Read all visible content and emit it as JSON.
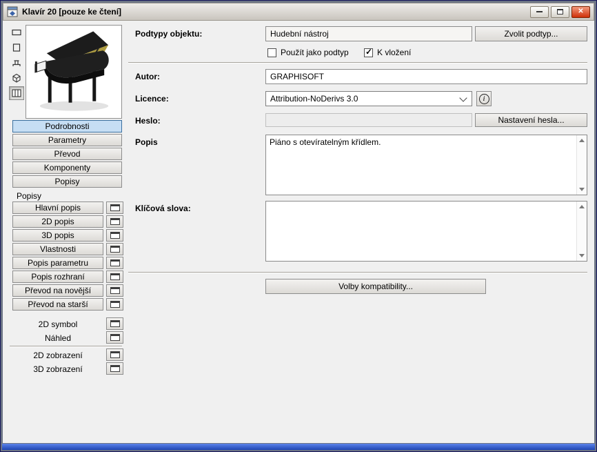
{
  "window": {
    "title": "Klavír 20 [pouze ke čtení]"
  },
  "sidebar": {
    "tools": [
      {
        "icon": "rect-icon",
        "selected": false
      },
      {
        "icon": "square-icon",
        "selected": false
      },
      {
        "icon": "stamp-icon",
        "selected": false
      },
      {
        "icon": "cube-icon",
        "selected": false
      },
      {
        "icon": "film-icon",
        "selected": true
      }
    ],
    "nav": [
      {
        "label": "Podrobnosti",
        "selected": true
      },
      {
        "label": "Parametry",
        "selected": false
      },
      {
        "label": "Převod",
        "selected": false
      },
      {
        "label": "Komponenty",
        "selected": false
      },
      {
        "label": "Popisy",
        "selected": false
      }
    ],
    "scripts_heading": "Popisy",
    "scripts": [
      {
        "label": "Hlavní popis"
      },
      {
        "label": "2D popis"
      },
      {
        "label": "3D popis"
      },
      {
        "label": "Vlastnosti"
      },
      {
        "label": "Popis parametru"
      },
      {
        "label": "Popis rozhraní"
      },
      {
        "label": "Převod na novější"
      },
      {
        "label": "Převod na starší"
      }
    ],
    "previews": [
      {
        "label": "2D symbol"
      },
      {
        "label": "Náhled"
      }
    ],
    "views": [
      {
        "label": "2D zobrazení"
      },
      {
        "label": "3D zobrazení"
      }
    ]
  },
  "main": {
    "subtype": {
      "label": "Podtypy objektu:",
      "value": "Hudební nástroj",
      "choose_button": "Zvolit podtyp...",
      "use_as_subtype": {
        "label": "Použít jako podtyp",
        "checked": false
      },
      "placeable": {
        "label": "K vložení",
        "checked": true
      }
    },
    "author": {
      "label": "Autor:",
      "value": "GRAPHISOFT"
    },
    "license": {
      "label": "Licence:",
      "value": "Attribution-NoDerivs 3.0"
    },
    "password": {
      "label": "Heslo:",
      "value": "",
      "button": "Nastavení hesla..."
    },
    "description": {
      "label": "Popis",
      "value": "Piáno s otevíratelným křídlem."
    },
    "keywords": {
      "label": "Klíčová slova:",
      "value": ""
    },
    "compatibility_button": "Volby kompatibility..."
  },
  "icons": {
    "titlebar": [
      "app-icon",
      "minimize-icon",
      "maximize-icon",
      "close-icon"
    ],
    "tools": [
      "rect-icon",
      "square-icon",
      "stamp-icon",
      "cube-icon",
      "film-icon"
    ],
    "script_open": "window-icon",
    "license_info": "info-icon",
    "dropdown": "chevron-down-icon",
    "scrollbar": [
      "scroll-up-icon",
      "scroll-down-icon"
    ]
  },
  "colors": {
    "selected_nav_bg": "#c6def4",
    "selected_nav_border": "#3a6f9f",
    "close_button": "#cf3009",
    "bottom_bar": "#2b57c8",
    "client_bg": "#f0f0f0",
    "lid_underside": "#ad9b3f"
  }
}
